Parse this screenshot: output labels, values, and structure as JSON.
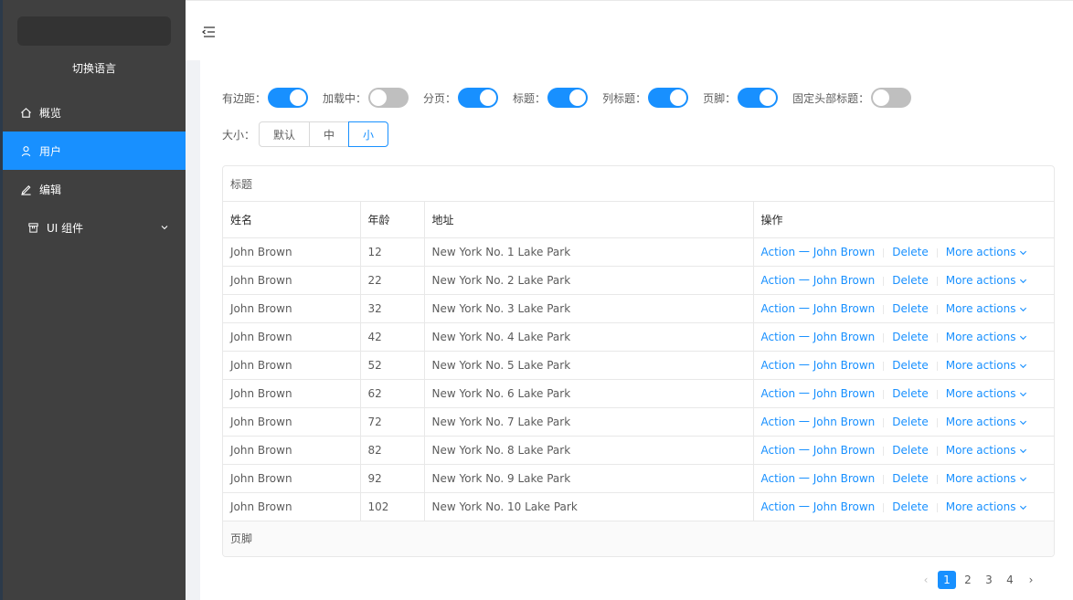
{
  "sidebar": {
    "language_switch": "切换语言",
    "items": [
      {
        "label": "概览"
      },
      {
        "label": "用户"
      },
      {
        "label": "编辑"
      },
      {
        "label": "UI 组件"
      }
    ]
  },
  "controls": [
    {
      "label": "有边距：",
      "on": true
    },
    {
      "label": "加载中：",
      "on": false
    },
    {
      "label": "分页：",
      "on": true
    },
    {
      "label": "标题：",
      "on": true
    },
    {
      "label": "列标题：",
      "on": true
    },
    {
      "label": "页脚：",
      "on": true
    },
    {
      "label": "固定头部标题：",
      "on": false
    }
  ],
  "size": {
    "label": "大小：",
    "options": [
      "默认",
      "中",
      "小"
    ],
    "selected": "小"
  },
  "table": {
    "title": "标题",
    "columns": [
      "姓名",
      "年龄",
      "地址",
      "操作"
    ],
    "rows": [
      {
        "name": "John Brown",
        "age": "12",
        "address": "New York No. 1 Lake Park",
        "action": "Action 一 John Brown"
      },
      {
        "name": "John Brown",
        "age": "22",
        "address": "New York No. 2 Lake Park",
        "action": "Action 一 John Brown"
      },
      {
        "name": "John Brown",
        "age": "32",
        "address": "New York No. 3 Lake Park",
        "action": "Action 一 John Brown"
      },
      {
        "name": "John Brown",
        "age": "42",
        "address": "New York No. 4 Lake Park",
        "action": "Action 一 John Brown"
      },
      {
        "name": "John Brown",
        "age": "52",
        "address": "New York No. 5 Lake Park",
        "action": "Action 一 John Brown"
      },
      {
        "name": "John Brown",
        "age": "62",
        "address": "New York No. 6 Lake Park",
        "action": "Action 一 John Brown"
      },
      {
        "name": "John Brown",
        "age": "72",
        "address": "New York No. 7 Lake Park",
        "action": "Action 一 John Brown"
      },
      {
        "name": "John Brown",
        "age": "82",
        "address": "New York No. 8 Lake Park",
        "action": "Action 一 John Brown"
      },
      {
        "name": "John Brown",
        "age": "92",
        "address": "New York No. 9 Lake Park",
        "action": "Action 一 John Brown"
      },
      {
        "name": "John Brown",
        "age": "102",
        "address": "New York No. 10 Lake Park",
        "action": "Action 一 John Brown"
      }
    ],
    "delete_label": "Delete",
    "more_label": "More actions",
    "footer": "页脚"
  },
  "pagination": {
    "pages": [
      "1",
      "2",
      "3",
      "4"
    ],
    "current": "1",
    "prev_icon": "‹",
    "next_icon": "›"
  },
  "colors": {
    "primary": "#1890ff",
    "sidebar_bg": "#404040"
  }
}
